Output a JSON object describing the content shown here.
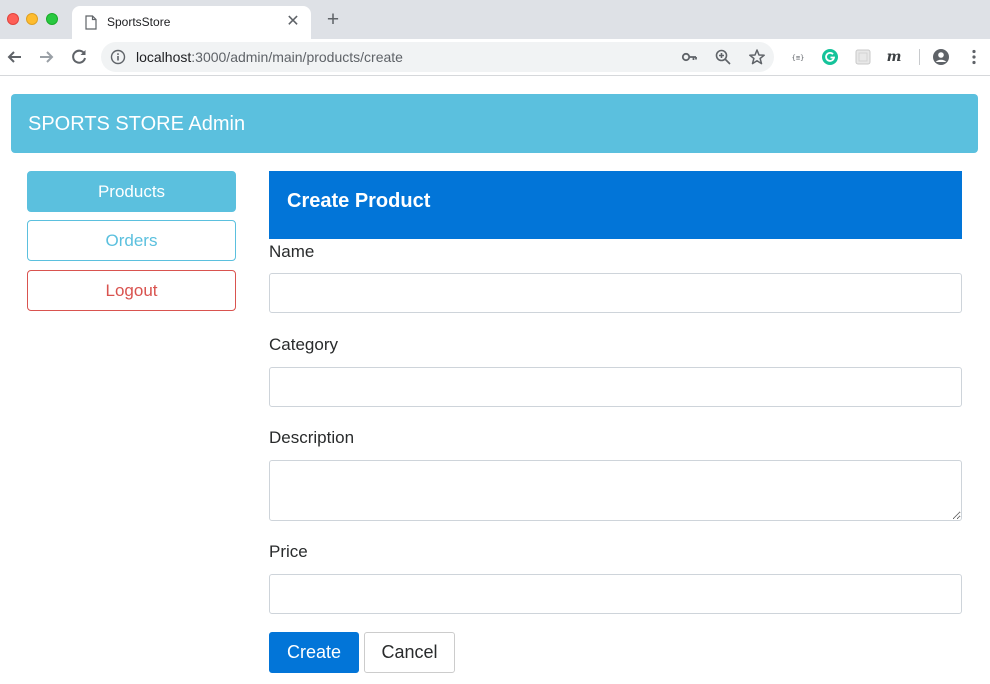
{
  "browser": {
    "tab_title": "SportsStore",
    "tab_close": "✕",
    "new_tab": "+",
    "url_host": "localhost",
    "url_path": ":3000/admin/main/products/create",
    "icons": [
      "page-icon",
      "back-arrow-icon",
      "forward-arrow-icon",
      "reload-icon",
      "info-icon",
      "key-icon",
      "zoom-icon",
      "star-icon",
      "json-extension-icon",
      "grammarly-icon",
      "extension-icon",
      "m-extension-icon",
      "account-icon",
      "menu-icon"
    ],
    "colors": {
      "tabbar": "#dee1e6",
      "omnibox": "#f1f3f4",
      "grammarly": "#15c39a"
    }
  },
  "admin": {
    "title": "SPORTS STORE Admin",
    "colors": {
      "header": "#5bc0de"
    }
  },
  "sidebar": {
    "items": [
      {
        "label": "Products",
        "style": "info-filled",
        "color": "#5bc0de"
      },
      {
        "label": "Orders",
        "style": "info-outline",
        "color": "#5bc0de"
      },
      {
        "label": "Logout",
        "style": "danger-outline",
        "color": "#d9534f"
      }
    ]
  },
  "form": {
    "title": "Create Product",
    "header_color": "#0275d8",
    "fields": [
      {
        "label": "Name",
        "value": "",
        "type": "input"
      },
      {
        "label": "Category",
        "value": "",
        "type": "input"
      },
      {
        "label": "Description",
        "value": "",
        "type": "textarea"
      },
      {
        "label": "Price",
        "value": "",
        "type": "input"
      }
    ],
    "create_label": "Create",
    "cancel_label": "Cancel"
  }
}
